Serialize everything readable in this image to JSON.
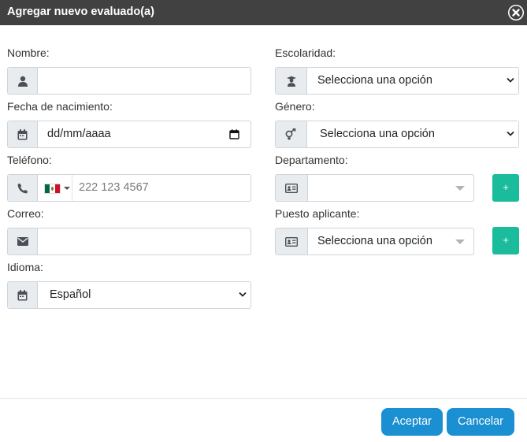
{
  "dialog": {
    "title": "Agregar nuevo evaluado(a)"
  },
  "left": {
    "nombre": {
      "label": "Nombre:",
      "value": ""
    },
    "fecha": {
      "label": "Fecha de nacimiento:",
      "placeholder": "dd/mm/aaaa"
    },
    "telefono": {
      "label": "Teléfono:",
      "placeholder": "222 123 4567",
      "country": "Mexico",
      "flag_colors": [
        "#006847",
        "#ffffff",
        "#ce1126"
      ]
    },
    "correo": {
      "label": "Correo:",
      "value": ""
    },
    "idioma": {
      "label": "Idioma:",
      "selected": "Español"
    }
  },
  "right": {
    "escolaridad": {
      "label": "Escolaridad:",
      "selected": "Selecciona una opción"
    },
    "genero": {
      "label": "Género:",
      "selected": "Selecciona una opción"
    },
    "departamento": {
      "label": "Departamento:",
      "selected": "",
      "add_label": "+"
    },
    "puesto": {
      "label": "Puesto aplicante:",
      "selected": "Selecciona una opción",
      "add_label": "+"
    }
  },
  "footer": {
    "accept_label": "Aceptar",
    "cancel_label": "Cancelar"
  },
  "colors": {
    "titlebar": "#414141",
    "addon_bg": "#e9ecef",
    "add_button": "#1abc9c",
    "primary_button": "#1a8fd1"
  },
  "icons": {
    "nombre": "user-icon",
    "fecha": "calendar-icon",
    "telefono": "phone-icon",
    "correo": "envelope-icon",
    "idioma": "calendar-icon",
    "escolaridad": "graduate-icon",
    "genero": "gender-icon",
    "departamento": "id-card-icon",
    "puesto": "id-card-icon"
  }
}
